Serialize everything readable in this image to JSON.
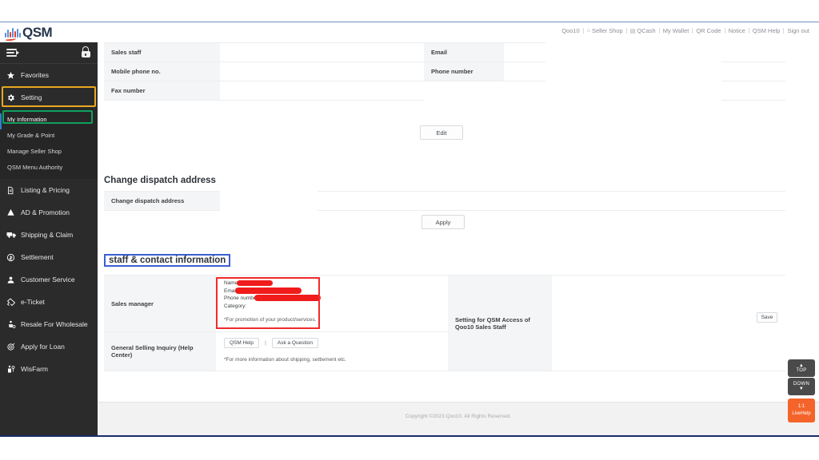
{
  "brand": {
    "logo_text": "QSM",
    "accent_blue": "#3b6fb6",
    "accent_red": "#e8402a",
    "dark": "#26354d"
  },
  "topnav": {
    "items": [
      {
        "label": "Qoo10",
        "icon": ""
      },
      {
        "label": "Seller Shop",
        "icon": "shop-icon"
      },
      {
        "label": "QCash",
        "icon": "cash-icon"
      },
      {
        "label": "My Wallet",
        "icon": ""
      },
      {
        "label": "QR Code",
        "icon": ""
      },
      {
        "label": "Notice",
        "icon": ""
      },
      {
        "label": "QSM Help",
        "icon": ""
      },
      {
        "label": "Sign out",
        "icon": ""
      }
    ]
  },
  "sidebar": {
    "collapse_icon": "hamburger-collapse-icon",
    "lock_icon": "lock-icon",
    "items": [
      {
        "label": "Favorites",
        "icon": "star-icon",
        "highlight": "none"
      },
      {
        "label": "Setting",
        "icon": "gear-icon",
        "highlight": "orange"
      },
      {
        "label": "Listing & Pricing",
        "icon": "document-icon",
        "highlight": "none"
      },
      {
        "label": "AD & Promotion",
        "icon": "megaphone-icon",
        "highlight": "none"
      },
      {
        "label": "Shipping & Claim",
        "icon": "truck-icon",
        "highlight": "none"
      },
      {
        "label": "Settlement",
        "icon": "coin-icon",
        "highlight": "none"
      },
      {
        "label": "Customer Service",
        "icon": "person-icon",
        "highlight": "none"
      },
      {
        "label": "e-Ticket",
        "icon": "ticket-icon",
        "highlight": "none"
      },
      {
        "label": "Resale For Wholesale",
        "icon": "resale-icon",
        "highlight": "none"
      },
      {
        "label": "Apply for Loan",
        "icon": "loan-icon",
        "highlight": "none"
      },
      {
        "label": "WisFarm",
        "icon": "farm-icon",
        "highlight": "none"
      }
    ],
    "setting_submenu": [
      {
        "label": "My Information",
        "selected": true
      },
      {
        "label": "My Grade & Point",
        "selected": false
      },
      {
        "label": "Manage Seller Shop",
        "selected": false
      },
      {
        "label": "QSM Menu Authority",
        "selected": false
      }
    ],
    "highlight_colors": {
      "orange": "#e9a820",
      "green": "#11a05e"
    }
  },
  "seller_info": {
    "left_rows": [
      {
        "label": "Sales staff",
        "value": ""
      },
      {
        "label": "Mobile phone no.",
        "value": ""
      },
      {
        "label": "Fax number",
        "value": ""
      }
    ],
    "right_rows": [
      {
        "label": "Email",
        "value": ""
      },
      {
        "label": "Phone number",
        "value": ""
      }
    ],
    "edit_label": "Edit"
  },
  "dispatch": {
    "title": "Change dispatch address",
    "row_label": "Change dispatch address",
    "row_value": "",
    "apply_label": "Apply"
  },
  "staff_contact": {
    "title": "staff & contact information",
    "title_highlight_color": "#3b5fd0",
    "rows": [
      {
        "label": "Sales manager",
        "fields": [
          {
            "key": "Name:",
            "value": "",
            "redacted": true
          },
          {
            "key": "Email:",
            "value": "",
            "redacted": true
          },
          {
            "key": "Phone number:",
            "value": "",
            "redacted": true
          },
          {
            "key": "Category:",
            "value": "",
            "redacted": false
          }
        ],
        "note": "*For promotion of your product/services.",
        "redaction_color": "#f01b1b"
      },
      {
        "label": "General Selling Inquiry (Help Center)",
        "buttons": [
          "QSM Help",
          "Ask a Question"
        ],
        "separator": "|",
        "note": "*For more information about shipping, settlement etc."
      }
    ],
    "right_label": "Setting for QSM Access of Qoo10 Sales Staff",
    "save_label": "Save"
  },
  "footer": {
    "copyright": "Copyright ©2023 Qoo10. All Rights Reserved."
  },
  "floating": {
    "top_label": "TOP",
    "top_arrow": "▲",
    "down_label": "DOWN",
    "down_arrow": "▼",
    "livehelp_line1": "1:1",
    "livehelp_line2": "LiveHelp",
    "livehelp_color": "#f4642a"
  }
}
